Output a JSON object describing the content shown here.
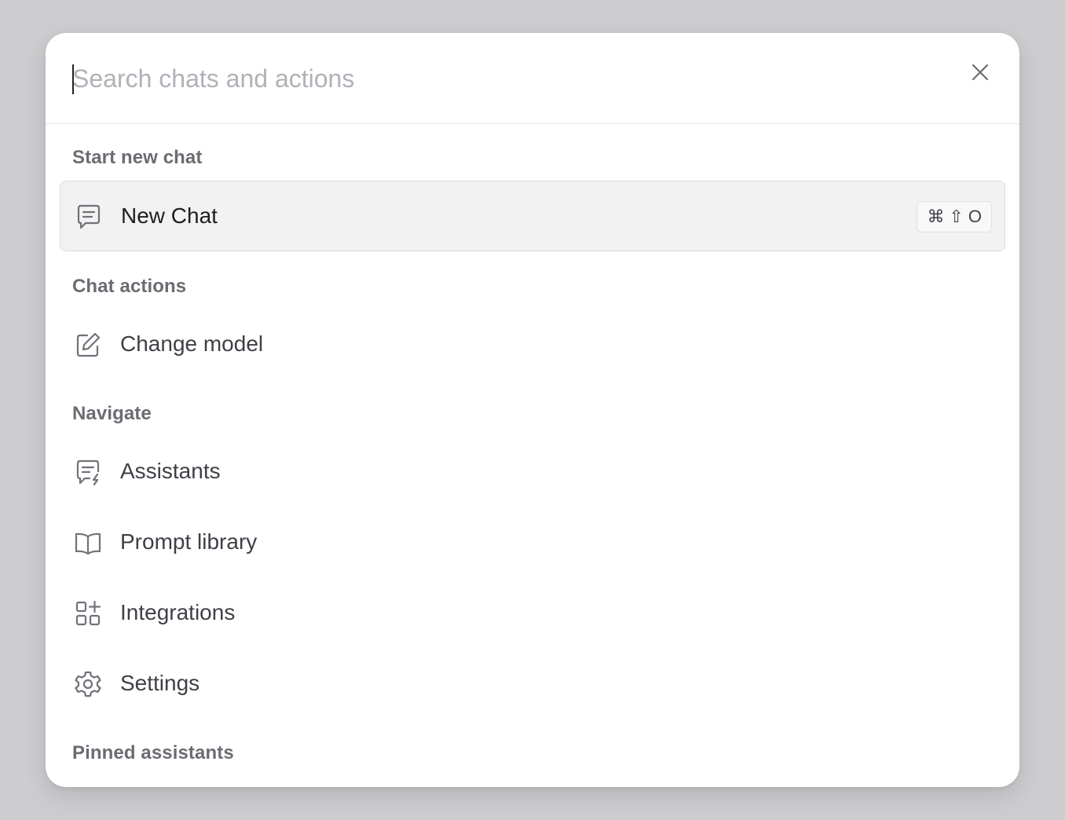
{
  "search": {
    "placeholder": "Search chats and actions",
    "value": ""
  },
  "sections": {
    "start_new_chat": "Start new chat",
    "chat_actions": "Chat actions",
    "navigate": "Navigate",
    "pinned_assistants": "Pinned assistants"
  },
  "items": {
    "new_chat": {
      "label": "New Chat",
      "icon": "chat-bubble-icon",
      "shortcut": [
        "⌘",
        "⇧",
        "O"
      ]
    },
    "change_model": {
      "label": "Change model",
      "icon": "pencil-edit-icon"
    },
    "assistants": {
      "label": "Assistants",
      "icon": "chat-bolt-icon"
    },
    "prompt_library": {
      "label": "Prompt library",
      "icon": "book-open-icon"
    },
    "integrations": {
      "label": "Integrations",
      "icon": "grid-plus-icon"
    },
    "settings": {
      "label": "Settings",
      "icon": "gear-icon"
    }
  },
  "colors": {
    "backdrop": "#cdcdd0",
    "panel": "#ffffff",
    "active_item_bg": "#f2f2f3",
    "section_label": "#6b6b72",
    "item_label": "#3f3f46",
    "placeholder": "#b1b1b7"
  }
}
